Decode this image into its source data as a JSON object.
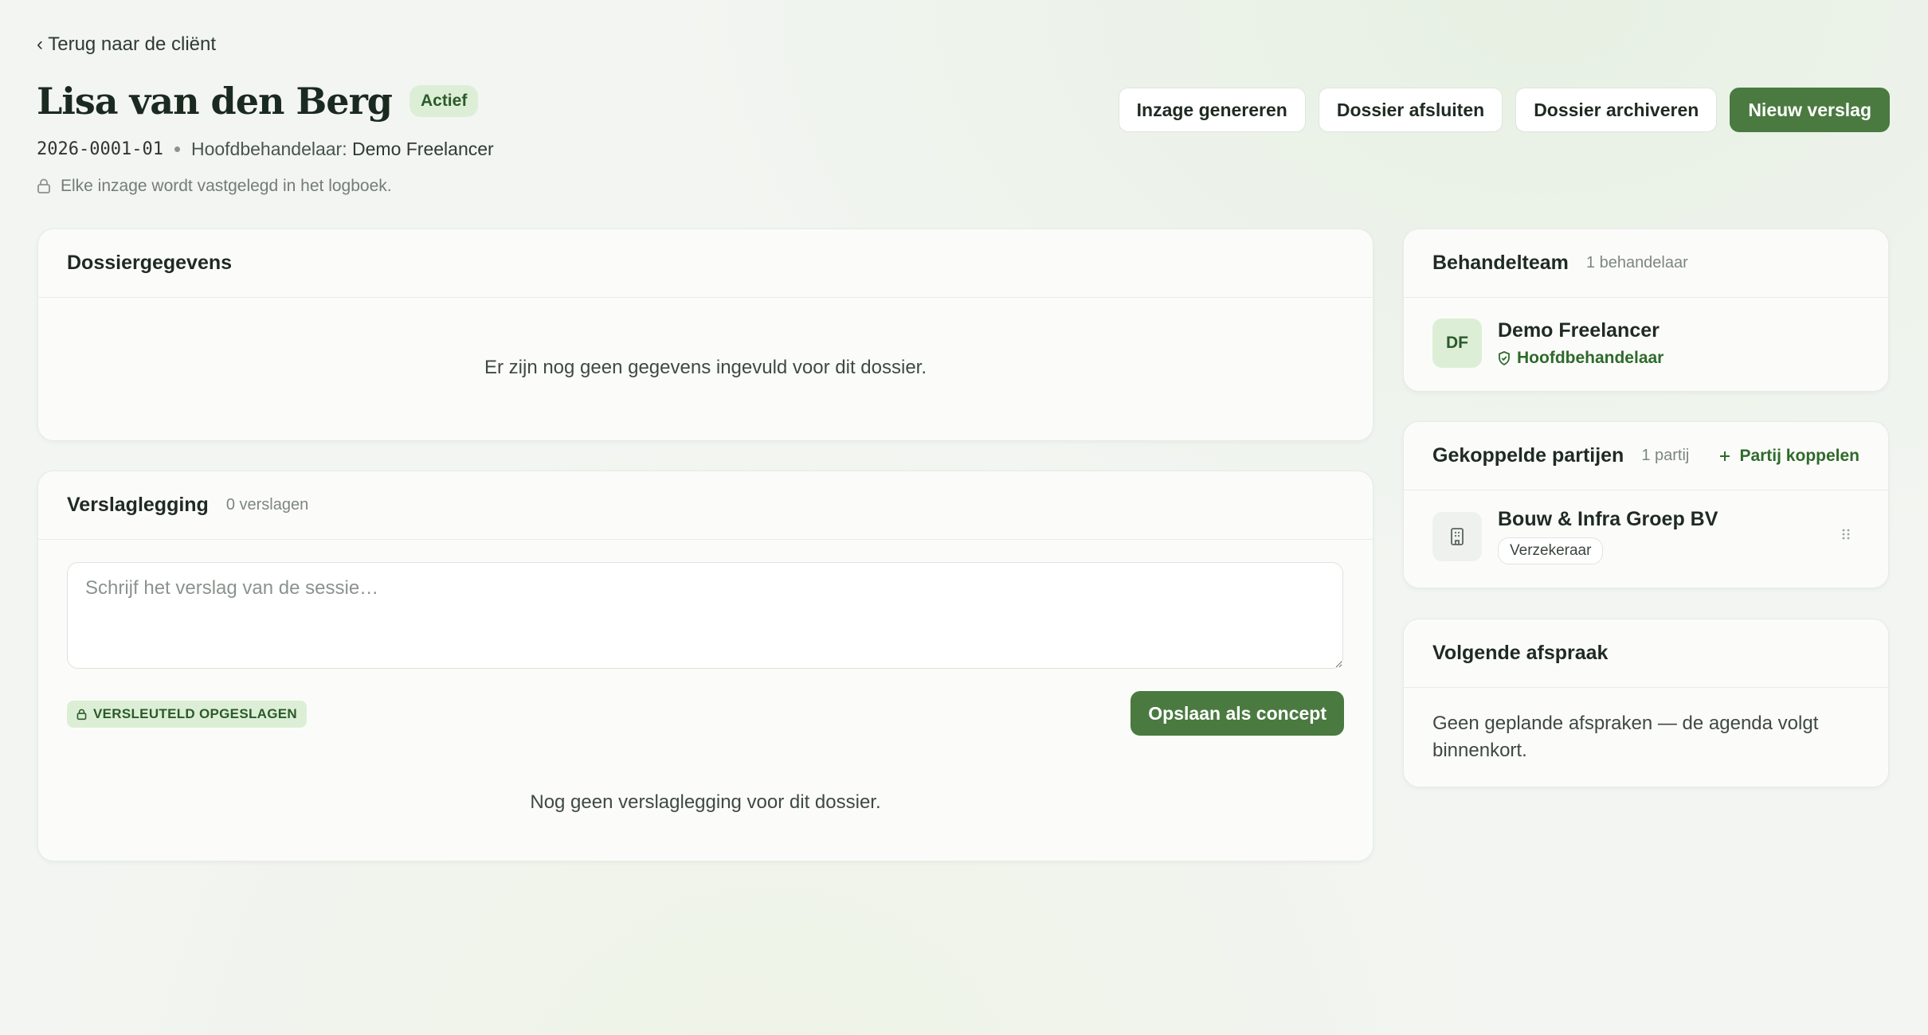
{
  "nav": {
    "back_label": "‹ Terug naar de cliënt"
  },
  "header": {
    "client_name": "Lisa van den Berg",
    "status": "Actief",
    "dossier_code": "2026-0001-01",
    "lead_label": "Hoofdbehandelaar:",
    "lead_name": "Demo Freelancer",
    "notice": "Elke inzage wordt vastgelegd in het logboek."
  },
  "actions": {
    "generate_access": "Inzage genereren",
    "close_dossier": "Dossier afsluiten",
    "archive_dossier": "Dossier archiveren",
    "new_report": "Nieuw verslag"
  },
  "dossier_details": {
    "title": "Dossiergegevens",
    "empty": "Er zijn nog geen gegevens ingevuld voor dit dossier."
  },
  "reports": {
    "title": "Verslaglegging",
    "count": "0 verslagen",
    "placeholder": "Schrijf het verslag van de sessie…",
    "encrypted_badge": "VERSLEUTELD OPGESLAGEN",
    "save_draft": "Opslaan als concept",
    "empty": "Nog geen verslaglegging voor dit dossier."
  },
  "team": {
    "title": "Behandelteam",
    "count": "1 behandelaar",
    "members": [
      {
        "initials": "DF",
        "name": "Demo Freelancer",
        "role": "Hoofdbehandelaar"
      }
    ]
  },
  "parties": {
    "title": "Gekoppelde partijen",
    "count": "1 partij",
    "link_label": "Partij koppelen",
    "items": [
      {
        "name": "Bouw & Infra Groep BV",
        "type": "Verzekeraar"
      }
    ]
  },
  "next_appointment": {
    "title": "Volgende afspraak",
    "empty": "Geen geplande afspraken — de agenda volgt binnenkort."
  },
  "colors": {
    "accent": "#4a7a40",
    "accent_light": "#dcefd6",
    "background": "#f2f5f1"
  }
}
